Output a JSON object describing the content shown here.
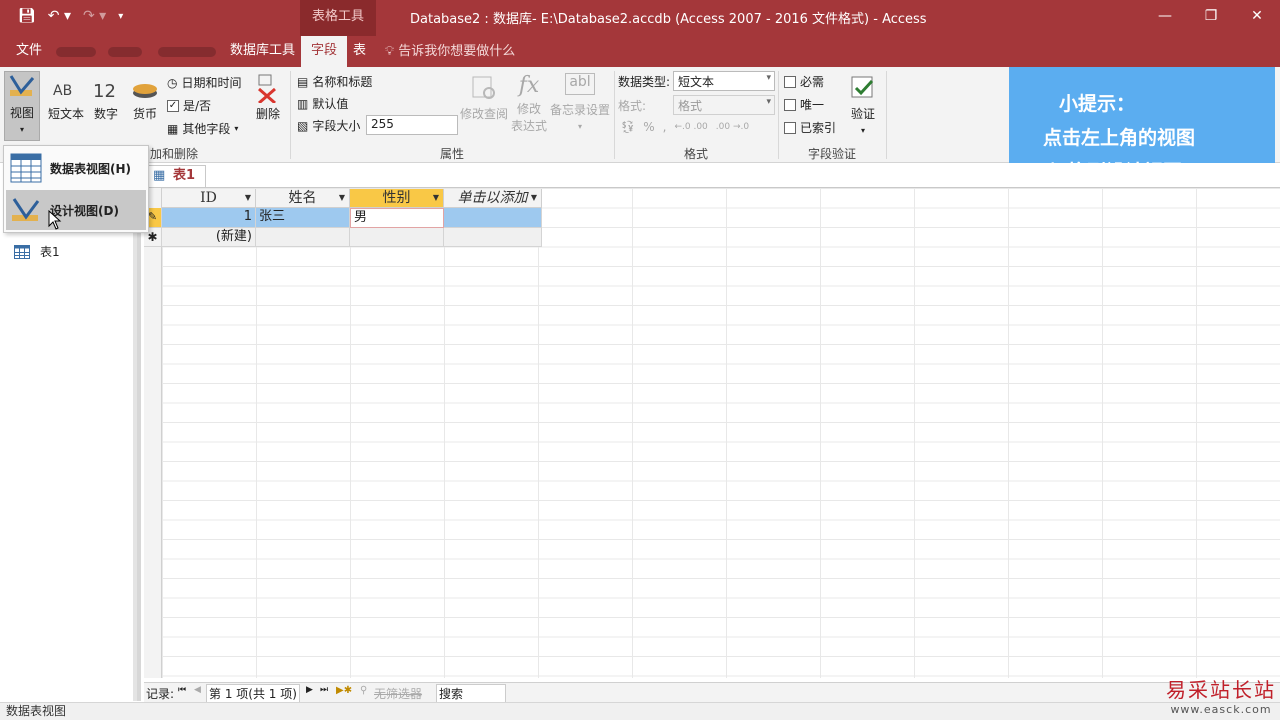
{
  "window": {
    "title": "Database2 : 数据库- E:\\Database2.accdb (Access 2007 - 2016 文件格式)  -  Access",
    "context_tab": "表格工具",
    "controls": [
      "—",
      "❐",
      "✕"
    ]
  },
  "ribbon_tabs": {
    "file": "文件",
    "db_tools": "数据库工具",
    "fields": "字段",
    "table": "表",
    "tell_me": "告诉我你想要做什么"
  },
  "ribbon": {
    "view": "视图",
    "short_text": "短文本",
    "number": "数字",
    "currency": "货币",
    "datetime": "日期和时间",
    "yesno": "是/否",
    "more_fields": "其他字段",
    "delete": "删除",
    "group_add_delete": "加和删除",
    "name_caption": "名称和标题",
    "default_value": "默认值",
    "field_size_label": "字段大小",
    "field_size_value": "255",
    "modify_lookups": "修改查阅",
    "modify_expression_1": "修改",
    "modify_expression_2": "表达式",
    "memo_settings": "备忘录设置",
    "group_properties": "属性",
    "data_type_label": "数据类型:",
    "data_type_value": "短文本",
    "format_label": "格式:",
    "format_value": "格式",
    "group_formatting": "格式",
    "required": "必需",
    "unique": "唯一",
    "indexed": "已索引",
    "validation": "验证",
    "group_validation": "字段验证"
  },
  "tip": {
    "line1": "小提示：",
    "line2": "点击左上角的视图",
    "line3": "切换到设计视图"
  },
  "view_menu": {
    "datasheet": "数据表视图(H)",
    "design": "设计视图(D)"
  },
  "nav": {
    "table_item": "表1"
  },
  "document_tab": "表1",
  "table": {
    "headers": [
      "ID",
      "姓名",
      "性别",
      "单击以添加"
    ],
    "row1": {
      "id": "1",
      "name": "张三",
      "gender": "男"
    },
    "new_row_label": "(新建)"
  },
  "record_nav": {
    "label": "记录:",
    "position": "第 1 项(共 1 项)",
    "filter": "无筛选器",
    "search": "搜索"
  },
  "status": "数据表视图",
  "watermark": {
    "name": "易采站长站",
    "url": "www.easck.com"
  }
}
